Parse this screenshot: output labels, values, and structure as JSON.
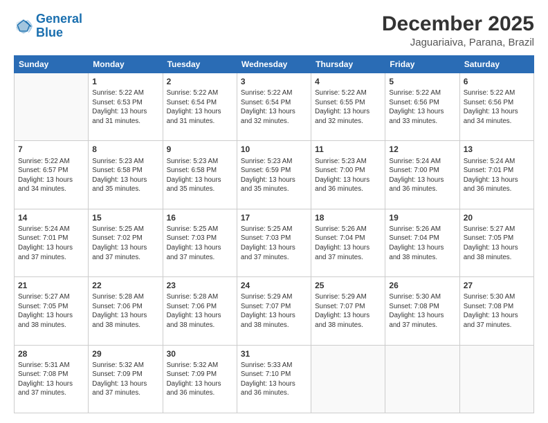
{
  "logo": {
    "text_general": "General",
    "text_blue": "Blue"
  },
  "header": {
    "title": "December 2025",
    "subtitle": "Jaguariaiva, Parana, Brazil"
  },
  "weekdays": [
    "Sunday",
    "Monday",
    "Tuesday",
    "Wednesday",
    "Thursday",
    "Friday",
    "Saturday"
  ],
  "weeks": [
    [
      {
        "day": "",
        "info": ""
      },
      {
        "day": "1",
        "info": "Sunrise: 5:22 AM\nSunset: 6:53 PM\nDaylight: 13 hours\nand 31 minutes."
      },
      {
        "day": "2",
        "info": "Sunrise: 5:22 AM\nSunset: 6:54 PM\nDaylight: 13 hours\nand 31 minutes."
      },
      {
        "day": "3",
        "info": "Sunrise: 5:22 AM\nSunset: 6:54 PM\nDaylight: 13 hours\nand 32 minutes."
      },
      {
        "day": "4",
        "info": "Sunrise: 5:22 AM\nSunset: 6:55 PM\nDaylight: 13 hours\nand 32 minutes."
      },
      {
        "day": "5",
        "info": "Sunrise: 5:22 AM\nSunset: 6:56 PM\nDaylight: 13 hours\nand 33 minutes."
      },
      {
        "day": "6",
        "info": "Sunrise: 5:22 AM\nSunset: 6:56 PM\nDaylight: 13 hours\nand 34 minutes."
      }
    ],
    [
      {
        "day": "7",
        "info": "Sunrise: 5:22 AM\nSunset: 6:57 PM\nDaylight: 13 hours\nand 34 minutes."
      },
      {
        "day": "8",
        "info": "Sunrise: 5:23 AM\nSunset: 6:58 PM\nDaylight: 13 hours\nand 35 minutes."
      },
      {
        "day": "9",
        "info": "Sunrise: 5:23 AM\nSunset: 6:58 PM\nDaylight: 13 hours\nand 35 minutes."
      },
      {
        "day": "10",
        "info": "Sunrise: 5:23 AM\nSunset: 6:59 PM\nDaylight: 13 hours\nand 35 minutes."
      },
      {
        "day": "11",
        "info": "Sunrise: 5:23 AM\nSunset: 7:00 PM\nDaylight: 13 hours\nand 36 minutes."
      },
      {
        "day": "12",
        "info": "Sunrise: 5:24 AM\nSunset: 7:00 PM\nDaylight: 13 hours\nand 36 minutes."
      },
      {
        "day": "13",
        "info": "Sunrise: 5:24 AM\nSunset: 7:01 PM\nDaylight: 13 hours\nand 36 minutes."
      }
    ],
    [
      {
        "day": "14",
        "info": "Sunrise: 5:24 AM\nSunset: 7:01 PM\nDaylight: 13 hours\nand 37 minutes."
      },
      {
        "day": "15",
        "info": "Sunrise: 5:25 AM\nSunset: 7:02 PM\nDaylight: 13 hours\nand 37 minutes."
      },
      {
        "day": "16",
        "info": "Sunrise: 5:25 AM\nSunset: 7:03 PM\nDaylight: 13 hours\nand 37 minutes."
      },
      {
        "day": "17",
        "info": "Sunrise: 5:25 AM\nSunset: 7:03 PM\nDaylight: 13 hours\nand 37 minutes."
      },
      {
        "day": "18",
        "info": "Sunrise: 5:26 AM\nSunset: 7:04 PM\nDaylight: 13 hours\nand 37 minutes."
      },
      {
        "day": "19",
        "info": "Sunrise: 5:26 AM\nSunset: 7:04 PM\nDaylight: 13 hours\nand 38 minutes."
      },
      {
        "day": "20",
        "info": "Sunrise: 5:27 AM\nSunset: 7:05 PM\nDaylight: 13 hours\nand 38 minutes."
      }
    ],
    [
      {
        "day": "21",
        "info": "Sunrise: 5:27 AM\nSunset: 7:05 PM\nDaylight: 13 hours\nand 38 minutes."
      },
      {
        "day": "22",
        "info": "Sunrise: 5:28 AM\nSunset: 7:06 PM\nDaylight: 13 hours\nand 38 minutes."
      },
      {
        "day": "23",
        "info": "Sunrise: 5:28 AM\nSunset: 7:06 PM\nDaylight: 13 hours\nand 38 minutes."
      },
      {
        "day": "24",
        "info": "Sunrise: 5:29 AM\nSunset: 7:07 PM\nDaylight: 13 hours\nand 38 minutes."
      },
      {
        "day": "25",
        "info": "Sunrise: 5:29 AM\nSunset: 7:07 PM\nDaylight: 13 hours\nand 38 minutes."
      },
      {
        "day": "26",
        "info": "Sunrise: 5:30 AM\nSunset: 7:08 PM\nDaylight: 13 hours\nand 37 minutes."
      },
      {
        "day": "27",
        "info": "Sunrise: 5:30 AM\nSunset: 7:08 PM\nDaylight: 13 hours\nand 37 minutes."
      }
    ],
    [
      {
        "day": "28",
        "info": "Sunrise: 5:31 AM\nSunset: 7:08 PM\nDaylight: 13 hours\nand 37 minutes."
      },
      {
        "day": "29",
        "info": "Sunrise: 5:32 AM\nSunset: 7:09 PM\nDaylight: 13 hours\nand 37 minutes."
      },
      {
        "day": "30",
        "info": "Sunrise: 5:32 AM\nSunset: 7:09 PM\nDaylight: 13 hours\nand 36 minutes."
      },
      {
        "day": "31",
        "info": "Sunrise: 5:33 AM\nSunset: 7:10 PM\nDaylight: 13 hours\nand 36 minutes."
      },
      {
        "day": "",
        "info": ""
      },
      {
        "day": "",
        "info": ""
      },
      {
        "day": "",
        "info": ""
      }
    ]
  ]
}
